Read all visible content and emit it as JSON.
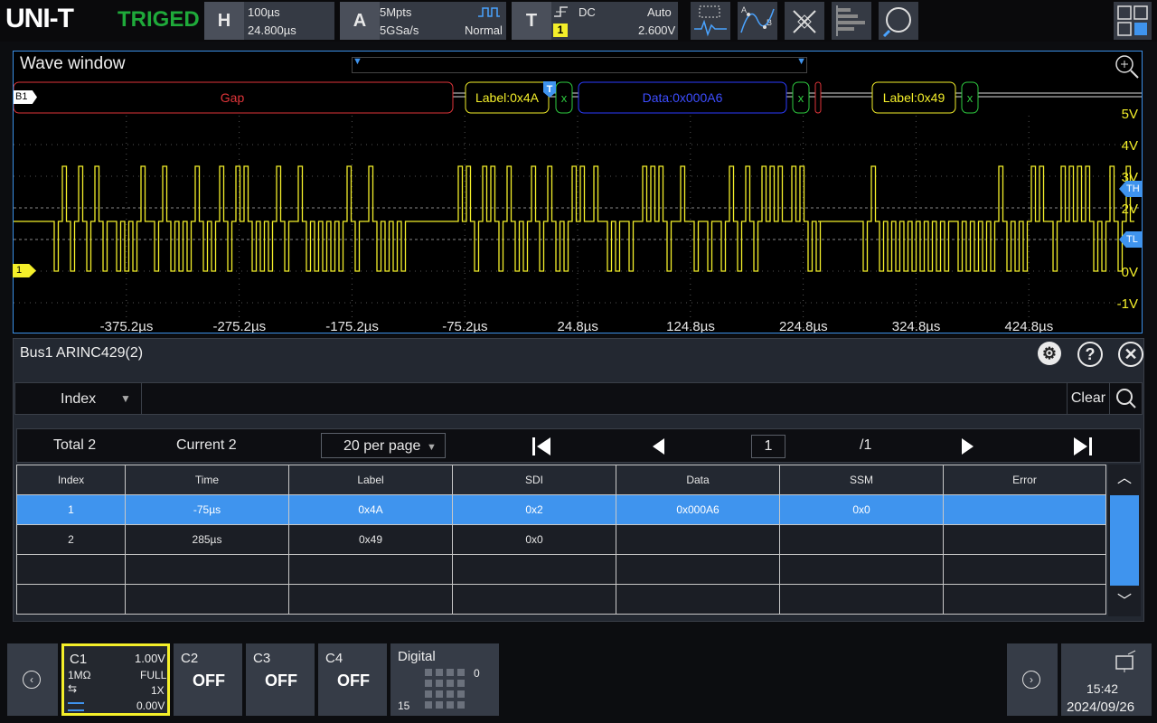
{
  "topbar": {
    "logo": "UNI-T",
    "trigger_status": "TRIGED",
    "horizontal": {
      "badge": "H",
      "timebase": "100µs",
      "offset": "24.800µs"
    },
    "acquire": {
      "badge": "A",
      "depth": "5Mpts",
      "rate": "5GSa/s",
      "mode": "Normal"
    },
    "trigger": {
      "badge": "T",
      "coupling": "DC",
      "sweep": "Auto",
      "source": "1",
      "level": "2.600V"
    }
  },
  "wave": {
    "title": "Wave window",
    "bus_tag": "B1",
    "ch_tag": "1",
    "trig_marker": "T",
    "th_marker": "TH",
    "tl_marker": "TL",
    "decode_segments": {
      "gap": "Gap",
      "label1": "Label:0x4A",
      "x": "x",
      "data1": "Data:0x000A6",
      "label2": "Label:0x49"
    },
    "y_ticks": [
      "5V",
      "4V",
      "3V",
      "2V",
      "0V",
      "-1V"
    ],
    "x_ticks": [
      "-375.2µs",
      "-275.2µs",
      "-175.2µs",
      "-75.2µs",
      "24.8µs",
      "124.8µs",
      "224.8µs",
      "324.8µs",
      "424.8µs"
    ]
  },
  "decode": {
    "title": "Bus1 ARINC429(2)",
    "search_field": "Index",
    "clear_label": "Clear",
    "total": "Total 2",
    "current": "Current 2",
    "per_page": "20 per page",
    "page": "1",
    "page_total": "/1",
    "columns": [
      "Index",
      "Time",
      "Label",
      "SDI",
      "Data",
      "SSM",
      "Error"
    ],
    "rows": [
      [
        "1",
        "-75µs",
        "0x4A",
        "0x2",
        "0x000A6",
        "0x0",
        ""
      ],
      [
        "2",
        "285µs",
        "0x49",
        "0x0",
        "",
        "",
        ""
      ]
    ]
  },
  "bottom": {
    "c1": {
      "name": "C1",
      "scale": "1.00V",
      "impedance": "1MΩ",
      "bw": "FULL",
      "probe": "1X",
      "offset": "0.00V"
    },
    "c2": {
      "name": "C2",
      "state": "OFF"
    },
    "c3": {
      "name": "C3",
      "state": "OFF"
    },
    "c4": {
      "name": "C4",
      "state": "OFF"
    },
    "digital": {
      "name": "Digital",
      "lo": "0",
      "hi": "15"
    },
    "time": "15:42",
    "date": "2024/09/26"
  },
  "colors": {
    "accent": "#3f94ee",
    "waveform": "#f4ef2a",
    "triged": "#1faa3a",
    "c1": "#f4ef2a"
  }
}
